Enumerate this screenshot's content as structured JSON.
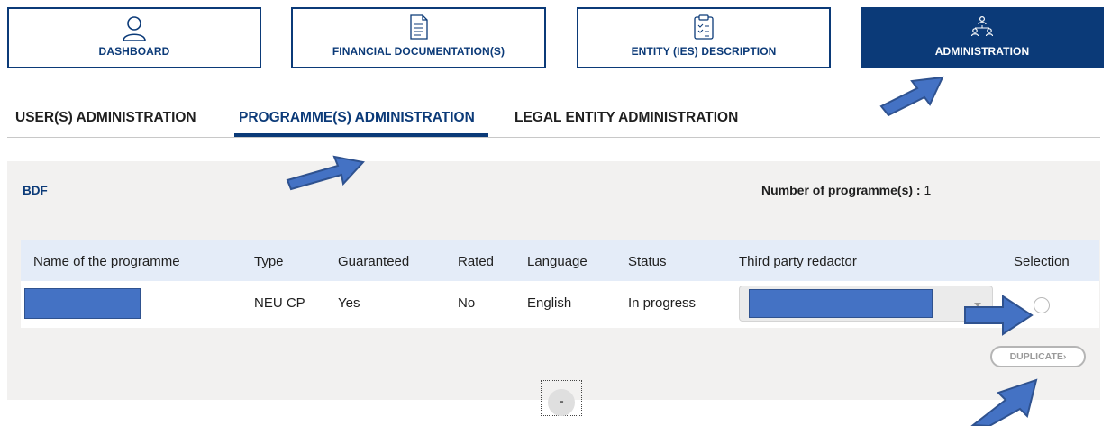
{
  "nav": {
    "dashboard": "DASHBOARD",
    "financial": "FINANCIAL DOCUMENTATION(S)",
    "entity": "ENTITY (IES) DESCRIPTION",
    "admin": "ADMINISTRATION"
  },
  "tabs": {
    "users": "USER(S) ADMINISTRATION",
    "programmes": "PROGRAMME(S) ADMINISTRATION",
    "legal": "LEGAL ENTITY ADMINISTRATION"
  },
  "panel": {
    "title": "BDF",
    "count_label": "Number of programme(s) :",
    "count_value": "1"
  },
  "table": {
    "headers": [
      "Name of the programme",
      "Type",
      "Guaranteed",
      "Rated",
      "Language",
      "Status",
      "Third party redactor",
      "Selection"
    ],
    "row": {
      "type": "NEU CP",
      "guaranteed": "Yes",
      "rated": "No",
      "language": "English",
      "status": "In progress"
    }
  },
  "buttons": {
    "duplicate": "DUPLICATE›",
    "collapse": "-"
  },
  "colors": {
    "brand": "#0b3a78",
    "header_bg": "#e4ecf8",
    "panel_bg": "#f2f1f0",
    "annotation_arrow": "#4472c4"
  },
  "icons": [
    "user-icon",
    "document-icon",
    "clipboard-icon",
    "org-chart-icon",
    "chevron-down-icon",
    "annotation-arrow"
  ]
}
